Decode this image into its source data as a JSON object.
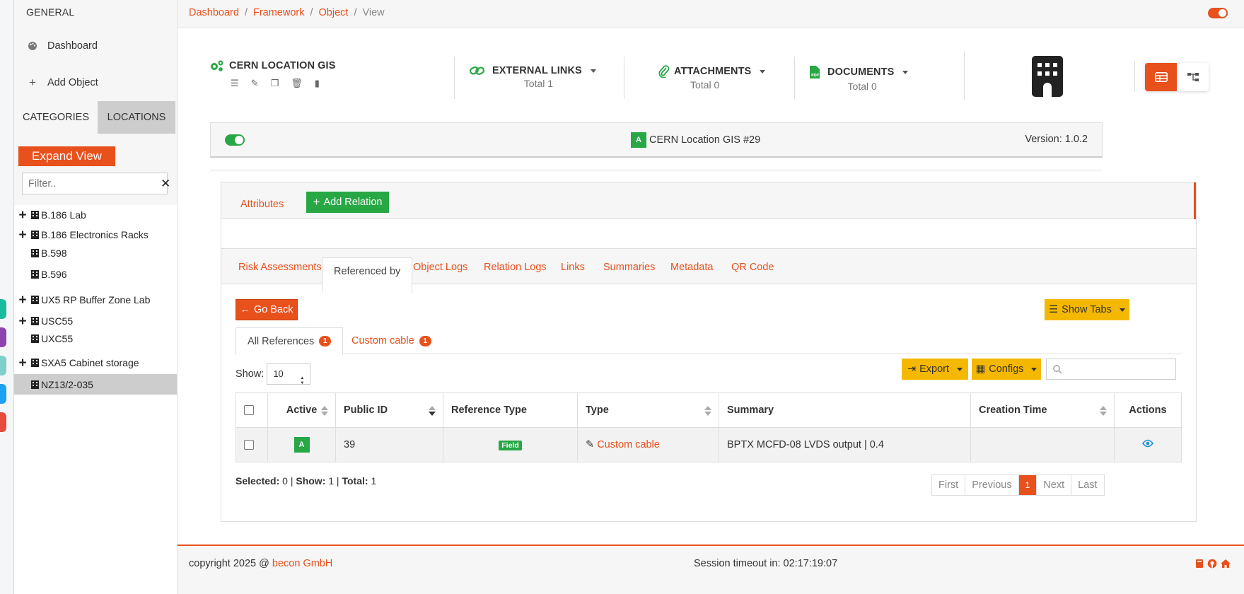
{
  "sidebar": {
    "section_title": "GENERAL",
    "menu": [
      {
        "label": "Dashboard",
        "icon": "palette-icon"
      },
      {
        "label": "Add Object",
        "icon": "plus-icon"
      }
    ],
    "tabs": [
      {
        "label": "CATEGORIES",
        "active": false
      },
      {
        "label": "LOCATIONS",
        "active": true
      }
    ],
    "expand_label": "Expand View",
    "filter_placeholder": "Filter..",
    "tree": [
      {
        "label": "B.186 Lab",
        "expandable": true
      },
      {
        "label": "B.186 Electronics Racks",
        "expandable": true
      },
      {
        "label": "B.598",
        "expandable": false
      },
      {
        "label": "B.596",
        "expandable": false
      },
      {
        "label": "UX5 RP Buffer Zone Lab",
        "expandable": true
      },
      {
        "label": "USC55",
        "expandable": true
      },
      {
        "label": "UXC55",
        "expandable": false
      },
      {
        "label": "SXA5 Cabinet storage",
        "expandable": true
      },
      {
        "label": "NZ13/2-035",
        "expandable": false,
        "selected": true
      }
    ]
  },
  "breadcrumb": [
    "Dashboard",
    "Framework",
    "Object",
    "View"
  ],
  "header": {
    "type_title": "CERN LOCATION GIS",
    "external_links": {
      "label": "EXTERNAL LINKS",
      "total": "Total 1"
    },
    "attachments": {
      "label": "ATTACHMENTS",
      "total": "Total 0"
    },
    "documents": {
      "label": "DOCUMENTS",
      "total": "Total 0"
    }
  },
  "object": {
    "status_letter": "A",
    "name": "CERN Location GIS #29",
    "version": "Version: 1.0.2"
  },
  "panel": {
    "attributes_label": "Attributes",
    "add_relation_label": "Add Relation"
  },
  "tabs": [
    {
      "label": "Risk Assessments",
      "active": false
    },
    {
      "label": "Referenced by",
      "active": true
    },
    {
      "label": "Object Logs",
      "active": false
    },
    {
      "label": "Relation Logs",
      "active": false
    },
    {
      "label": "Links",
      "active": false
    },
    {
      "label": "Summaries",
      "active": false
    },
    {
      "label": "Metadata",
      "active": false
    },
    {
      "label": "QR Code",
      "active": false
    }
  ],
  "refs": {
    "go_back": "Go Back",
    "show_tabs": "Show Tabs",
    "subtabs": [
      {
        "label": "All References",
        "count": "1",
        "active": true
      },
      {
        "label": "Custom cable",
        "count": "1",
        "active": false
      }
    ],
    "show_label": "Show:",
    "show_value": "10",
    "export_label": "Export",
    "configs_label": "Configs",
    "columns": [
      "Active",
      "Public ID",
      "Reference Type",
      "Type",
      "Summary",
      "Creation Time",
      "Actions"
    ],
    "rows": [
      {
        "active": "A",
        "public_id": "39",
        "reference_type": "Field",
        "type": "Custom cable",
        "summary": "BPTX MCFD-08 LVDS output | 0.4",
        "creation_time": ""
      }
    ],
    "selected_label": "Selected:",
    "selected_value": "0",
    "show_count_label": "Show:",
    "show_count_value": "1",
    "total_label": "Total:",
    "total_value": "1",
    "pagination": [
      "First",
      "Previous",
      "1",
      "Next",
      "Last"
    ]
  },
  "footer": {
    "copyright_prefix": "copyright 2025 @",
    "company": "becon GmbH",
    "session": "Session timeout in: 02:17:19:07"
  },
  "colors": {
    "accent": "#e8501c",
    "success": "#28a745",
    "warning": "#f5b800"
  }
}
